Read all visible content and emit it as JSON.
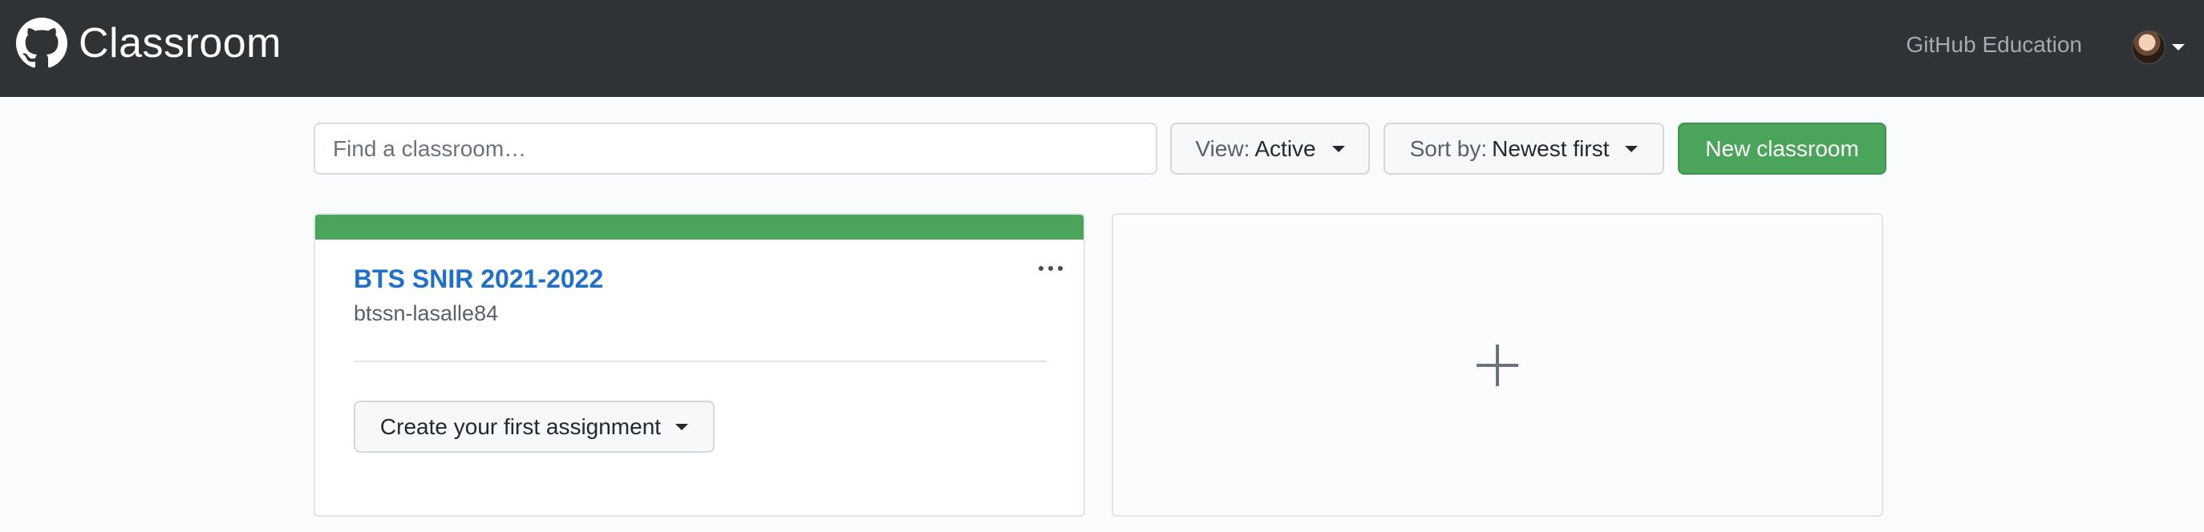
{
  "header": {
    "brand_name": "Classroom",
    "brand_icon": "github-octocat-icon",
    "education_link": "GitHub Education",
    "avatar_icon": "user-avatar",
    "menu_caret_icon": "caret-down-icon"
  },
  "toolbar": {
    "search_placeholder": "Find a classroom…",
    "search_value": "",
    "view_label": "View:",
    "view_value": "Active",
    "sort_label": "Sort by:",
    "sort_value": "Newest first",
    "new_label": "New classroom"
  },
  "classrooms": [
    {
      "title": "BTS SNIR 2021-2022",
      "org": "btssn-lasalle84",
      "assignment_button": "Create your first assignment",
      "menu_icon": "kebab-menu-icon",
      "accent_color": "#4aa55a"
    }
  ],
  "new_card": {
    "icon": "plus-icon"
  },
  "colors": {
    "header_bg": "#2f3336",
    "primary_green": "#4aa55a",
    "link_blue": "#1f6fcc",
    "page_bg": "#fafbfc"
  }
}
